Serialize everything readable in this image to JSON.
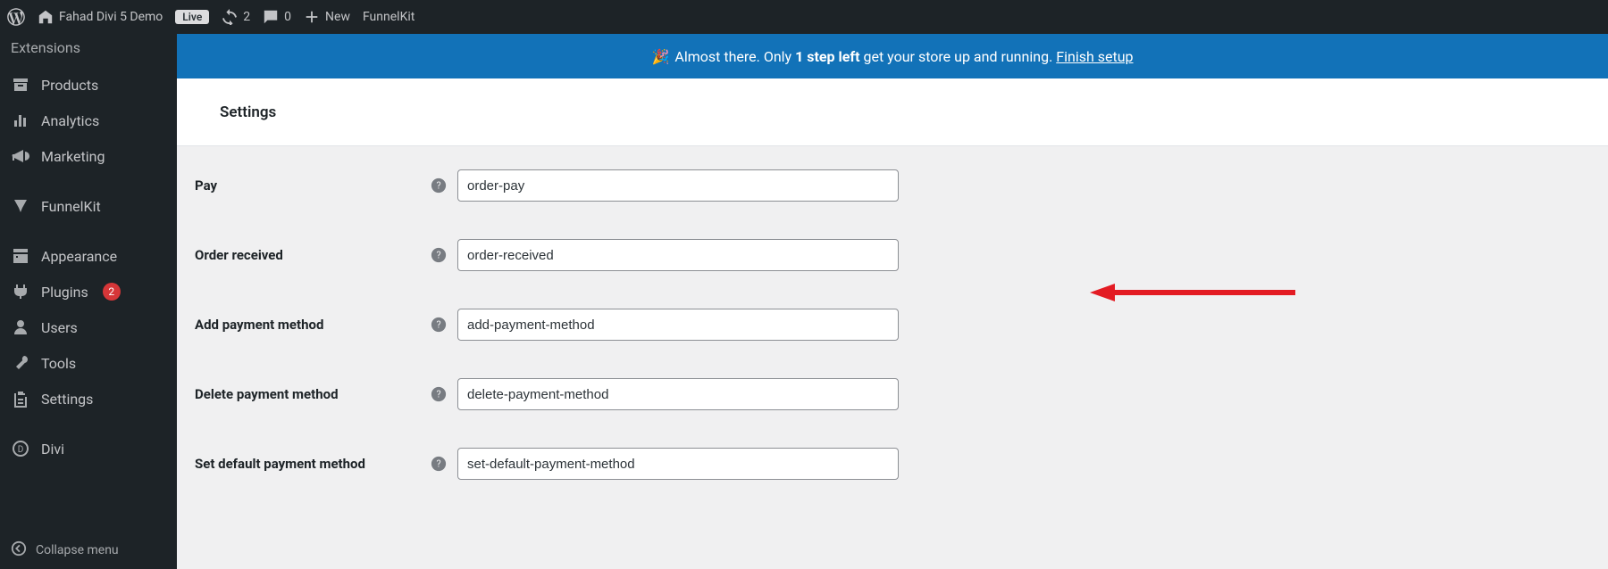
{
  "adminbar": {
    "site_name": "Fahad Divi 5 Demo",
    "status_label": "Live",
    "updates_count": "2",
    "comments_count": "0",
    "new_label": "New",
    "funnelkit_label": "FunnelKit"
  },
  "sidebar": {
    "extensions": "Extensions",
    "products": "Products",
    "analytics": "Analytics",
    "marketing": "Marketing",
    "funnelkit": "FunnelKit",
    "appearance": "Appearance",
    "plugins": "Plugins",
    "plugins_count": "2",
    "users": "Users",
    "tools": "Tools",
    "settings": "Settings",
    "divi": "Divi",
    "collapse": "Collapse menu"
  },
  "banner": {
    "emoji": "🎉",
    "text_before": "Almost there. Only ",
    "bold": "1 step left",
    "text_after": " get your store up and running. ",
    "link": "Finish setup",
    "bg": "#1272b8"
  },
  "header": {
    "title": "Settings"
  },
  "fields": [
    {
      "label": "Pay",
      "value": "order-pay"
    },
    {
      "label": "Order received",
      "value": "order-received"
    },
    {
      "label": "Add payment method",
      "value": "add-payment-method"
    },
    {
      "label": "Delete payment method",
      "value": "delete-payment-method"
    },
    {
      "label": "Set default payment method",
      "value": "set-default-payment-method"
    }
  ]
}
